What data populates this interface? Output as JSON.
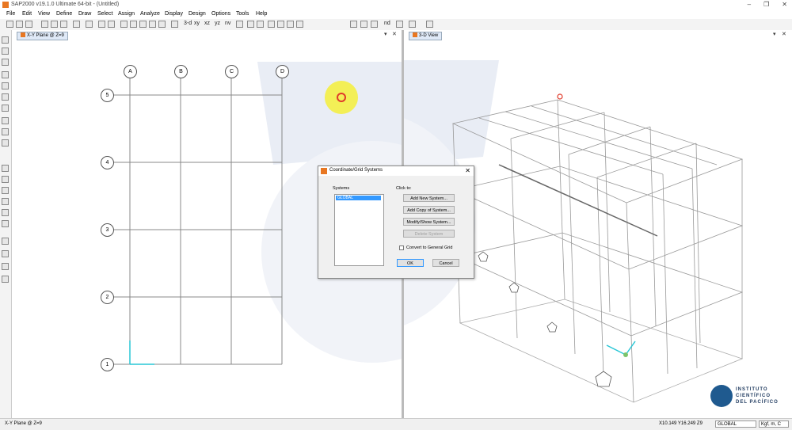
{
  "app": {
    "title": "SAP2000 v19.1.0 Ultimate 64-bit - (Untitled)"
  },
  "menu": [
    "File",
    "Edit",
    "View",
    "Define",
    "Draw",
    "Select",
    "Assign",
    "Analyze",
    "Display",
    "Design",
    "Options",
    "Tools",
    "Help"
  ],
  "toolbar": {
    "view_3d": "3-d",
    "view_xy": "xy",
    "view_xz": "xz",
    "view_yz": "yz",
    "view_nv": "nv",
    "view_nd": "nd"
  },
  "panes": {
    "left": {
      "tab": "X-Y Plane @ Z=9",
      "grid_x": [
        "A",
        "B",
        "C",
        "D"
      ],
      "grid_y": [
        "5",
        "4",
        "3",
        "2",
        "1"
      ]
    },
    "right": {
      "tab": "3-D View"
    }
  },
  "dialog": {
    "title": "Coordinate/Grid Systems",
    "systems_label": "Systems",
    "click_to_label": "Click to:",
    "systems": [
      "GLOBAL"
    ],
    "buttons": [
      "Add New System...",
      "Add Copy of System...",
      "Modify/Show System...",
      "Delete System"
    ],
    "checkbox": "Convert to General Grid",
    "ok": "OK",
    "cancel": "Cancel"
  },
  "status": {
    "left": "X-Y Plane @ Z=9",
    "coords": "X10.149  Y16.249  Z9",
    "coord_system": "GLOBAL",
    "units": "Kgf, m, C"
  },
  "logo": {
    "line1": "INSTITUTO",
    "line2": "CIENTÍFICO",
    "line3": "DEL PACÍFICO"
  },
  "colors": {
    "accent": "#e87722",
    "highlight": "#f5ee3a",
    "axis": "#29c7d6",
    "logo_blue": "#1f5a8f"
  }
}
